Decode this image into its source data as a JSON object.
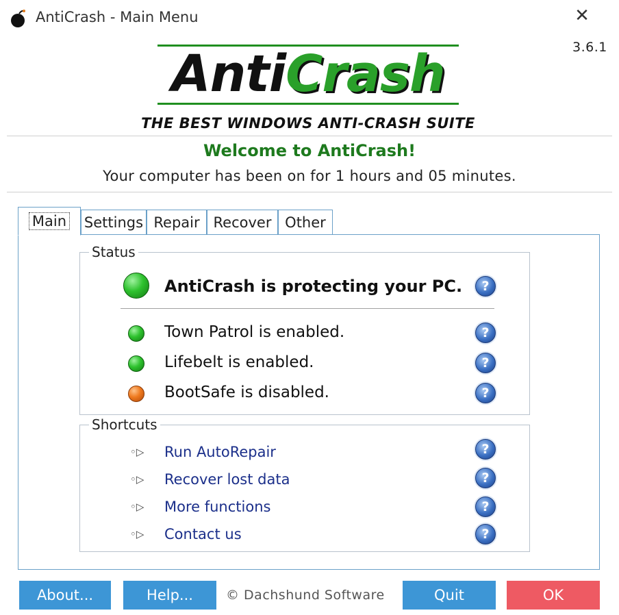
{
  "window": {
    "title": "AntiCrash - Main Menu",
    "close_glyph": "✕",
    "version": "3.6.1"
  },
  "header": {
    "logo_part1": "Anti",
    "logo_part2": "Crash",
    "tagline": "THE BEST WINDOWS ANTI-CRASH SUITE",
    "welcome": "Welcome to AntiCrash!",
    "uptime": "Your computer has been on for 1 hours and 05 minutes."
  },
  "tabs": [
    {
      "label": "Main",
      "selected": true
    },
    {
      "label": "Settings",
      "selected": false
    },
    {
      "label": "Repair",
      "selected": false
    },
    {
      "label": "Recover",
      "selected": false
    },
    {
      "label": "Other",
      "selected": false
    }
  ],
  "status": {
    "label": "Status",
    "main": {
      "text": "AntiCrash is protecting your PC.",
      "state": "green"
    },
    "items": [
      {
        "text": "Town Patrol is enabled.",
        "state": "green"
      },
      {
        "text": "Lifebelt is enabled.",
        "state": "green"
      },
      {
        "text": "BootSafe is disabled.",
        "state": "orange"
      }
    ]
  },
  "shortcuts": {
    "label": "Shortcuts",
    "items": [
      {
        "text": "Run AutoRepair"
      },
      {
        "text": "Recover lost data"
      },
      {
        "text": "More functions"
      },
      {
        "text": "Contact us"
      }
    ]
  },
  "icons": {
    "help": "?",
    "bullet": "◦▷"
  },
  "footer": {
    "about_label": "About...",
    "help_label": "Help...",
    "copyright": "© Dachshund Software",
    "quit_label": "Quit",
    "ok_label": "OK"
  },
  "colors": {
    "accent_blue": "#3d96d6",
    "ok_red": "#ee5a63",
    "welcome_green": "#1e7a1e",
    "link_blue": "#1b2f8a",
    "status_green": "#2ec22e",
    "status_orange": "#ef7a1f"
  }
}
